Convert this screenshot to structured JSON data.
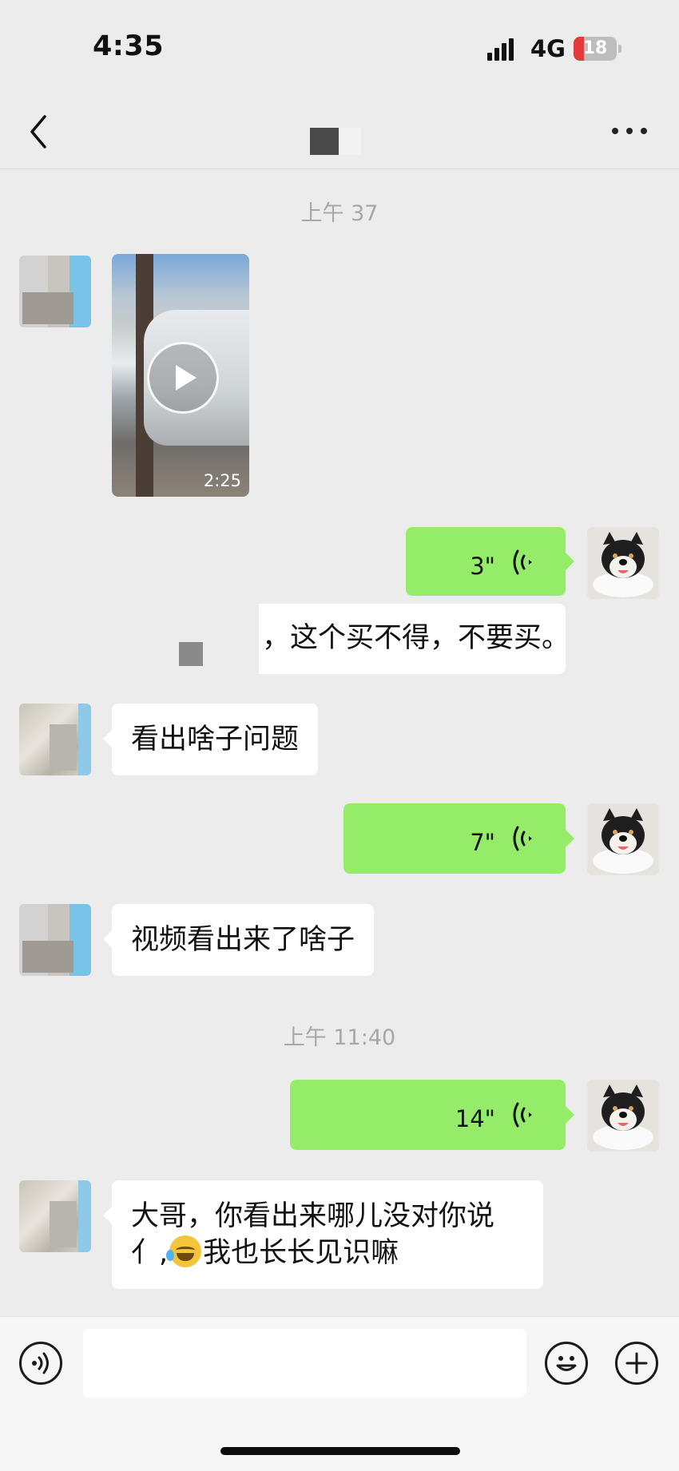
{
  "status_bar": {
    "time": "4:35",
    "network": "4G",
    "battery": "18",
    "battery_color": "#e23b3b"
  },
  "nav": {
    "back_icon": "chevron-left-icon",
    "more_icon": "more-dots-icon"
  },
  "messages": {
    "ts1": "上午 37",
    "video_duration": "2:25",
    "voice1_duration": "3\"",
    "reply1_text": "，这个买不得，不要买。",
    "in1_text": "看出啥子问题",
    "voice2_duration": "7\"",
    "in2_text": "视频看出来了啥子",
    "ts2": "上午 11:40",
    "voice3_duration": "14\"",
    "in3_line1": "大哥，你看出来哪儿没对你说",
    "in3_line2_a": "亻,",
    "in3_line2_b": "我也长长见识嘛"
  },
  "colors": {
    "chat_bg": "#ececec",
    "outgoing_bubble": "#95ec69",
    "incoming_bubble": "#ffffff"
  }
}
